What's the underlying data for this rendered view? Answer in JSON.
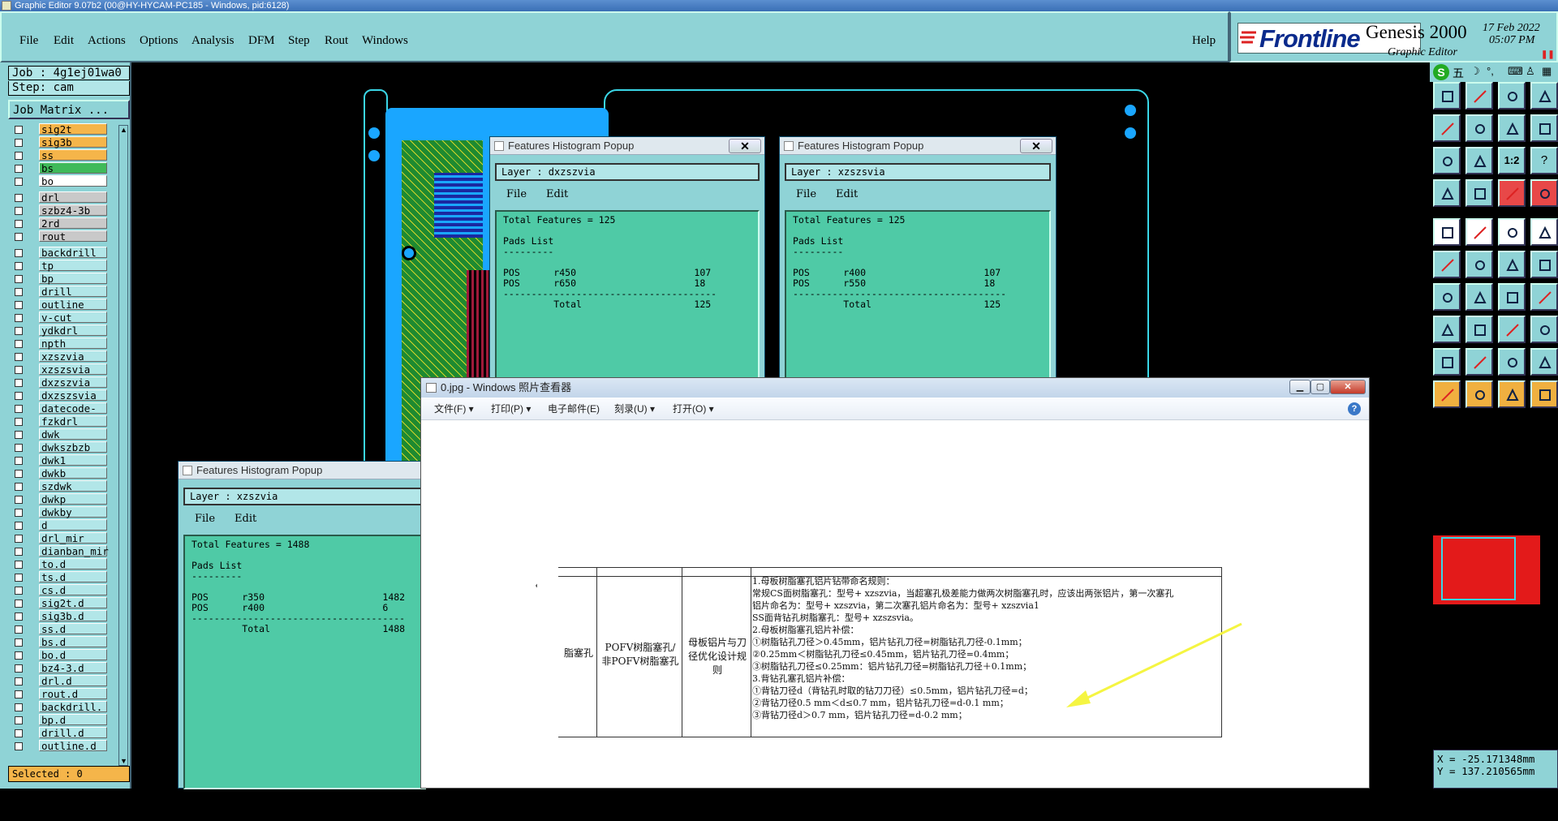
{
  "titlebar": {
    "title": "Graphic Editor 9.07b2 (00@HY-HYCAM-PC185 - Windows, pid:6128)"
  },
  "menubar": {
    "items": [
      "File",
      "Edit",
      "Actions",
      "Options",
      "Analysis",
      "DFM",
      "Step",
      "Rout",
      "Windows"
    ],
    "help": "Help"
  },
  "brand": {
    "logo": "Frontline",
    "product": "Genesis 2000",
    "subtitle": "Graphic Editor",
    "date": "17 Feb 2022",
    "time": "05:07 PM",
    "ime": "五"
  },
  "job": {
    "job": "Job : 4g1ej01wa0",
    "step": "Step: cam",
    "matrix": "Job Matrix ..."
  },
  "layers": [
    {
      "name": "sig2t",
      "color": "orange"
    },
    {
      "name": "sig3b",
      "color": "orange"
    },
    {
      "name": "ss",
      "color": "orange"
    },
    {
      "name": "bs",
      "color": "green"
    },
    {
      "name": "bo",
      "color": "white"
    },
    {
      "name": "drl",
      "color": "grey"
    },
    {
      "name": "szbz4-3b",
      "color": "grey"
    },
    {
      "name": "2rd",
      "color": "grey"
    },
    {
      "name": "rout",
      "color": "grey"
    },
    {
      "name": "backdrill",
      "color": "cyan"
    },
    {
      "name": "tp",
      "color": "cyan"
    },
    {
      "name": "bp",
      "color": "cyan"
    },
    {
      "name": "drill",
      "color": "cyan"
    },
    {
      "name": "outline",
      "color": "cyan"
    },
    {
      "name": "v-cut",
      "color": "cyan"
    },
    {
      "name": "ydkdrl",
      "color": "cyan"
    },
    {
      "name": "npth",
      "color": "cyan"
    },
    {
      "name": "xzszvia",
      "color": "cyan"
    },
    {
      "name": "xzszsvia",
      "color": "cyan"
    },
    {
      "name": "dxzszvia",
      "color": "cyan"
    },
    {
      "name": "dxzszsvia",
      "color": "cyan"
    },
    {
      "name": "datecode-to",
      "color": "cyan"
    },
    {
      "name": "fzkdrl",
      "color": "cyan"
    },
    {
      "name": "dwk",
      "color": "cyan"
    },
    {
      "name": "dwkszbzb",
      "color": "cyan"
    },
    {
      "name": "dwk1",
      "color": "cyan"
    },
    {
      "name": "dwkb",
      "color": "cyan"
    },
    {
      "name": "szdwk",
      "color": "cyan"
    },
    {
      "name": "dwkp",
      "color": "cyan"
    },
    {
      "name": "dwkby",
      "color": "cyan"
    },
    {
      "name": "d",
      "color": "cyan"
    },
    {
      "name": "drl_mir",
      "color": "cyan"
    },
    {
      "name": "dianban_mir",
      "color": "cyan"
    },
    {
      "name": "to.d",
      "color": "cyan"
    },
    {
      "name": "ts.d",
      "color": "cyan"
    },
    {
      "name": "cs.d",
      "color": "cyan"
    },
    {
      "name": "sig2t.d",
      "color": "cyan"
    },
    {
      "name": "sig3b.d",
      "color": "cyan"
    },
    {
      "name": "ss.d",
      "color": "cyan"
    },
    {
      "name": "bs.d",
      "color": "cyan"
    },
    {
      "name": "bo.d",
      "color": "cyan"
    },
    {
      "name": "bz4-3.d",
      "color": "cyan"
    },
    {
      "name": "drl.d",
      "color": "cyan"
    },
    {
      "name": "rout.d",
      "color": "cyan"
    },
    {
      "name": "backdrill.",
      "color": "cyan"
    },
    {
      "name": "bp.d",
      "color": "cyan"
    },
    {
      "name": "drill.d",
      "color": "cyan"
    },
    {
      "name": "outline.d",
      "color": "cyan"
    }
  ],
  "selected": "Selected : 0",
  "popups": [
    {
      "title": "Features Histogram Popup",
      "layer": "Layer :  dxzszvia",
      "menu": [
        "File",
        "Edit"
      ],
      "body": "Total Features = 125\n\nPads List\n---------\n\nPOS      r450                     107\nPOS      r650                     18\n--------------------------------------\n         Total                    125"
    },
    {
      "title": "Features Histogram Popup",
      "layer": "Layer :  xzszsvia",
      "menu": [
        "File",
        "Edit"
      ],
      "body": "Total Features = 125\n\nPads List\n---------\n\nPOS      r400                     107\nPOS      r550                     18\n--------------------------------------\n         Total                    125"
    },
    {
      "title": "Features Histogram Popup",
      "layer": "Layer :  xzszvia",
      "menu": [
        "File",
        "Edit"
      ],
      "body": "Total Features = 1488\n\nPads List\n---------\n\nPOS      r350                     1482\nPOS      r400                     6\n--------------------------------------\n         Total                    1488"
    }
  ],
  "viewer": {
    "title": "0.jpg - Windows 照片查看器",
    "menu": [
      "文件(F)",
      "打印(P)",
      "电子邮件(E)",
      "刻录(U)",
      "打开(O)"
    ],
    "doc": {
      "col1": "脂塞孔",
      "col2": "POFV树脂塞孔/非POFV树脂塞孔",
      "col3": "母板铝片与刀径优化设计规则",
      "rules": [
        "1.母板树脂塞孔铝片钻带命名规则：",
        "常规CS面树脂塞孔：型号+ xzszvia，当超塞孔极差能力做两次树脂塞孔时，应该出两张铝片，第一次塞孔",
        "铝片命名为：型号+ xzszvia，第二次塞孔铝片命名为：型号+ xzszvia1",
        "SS面背钻孔树脂塞孔：型号+ xzszsvia。",
        "2.母板树脂塞孔铝片补偿：",
        "①树脂钻孔刀径＞0.45mm，铝片钻孔刀径=树脂钻孔刀径-0.1mm；",
        "②0.25mm＜树脂钻孔刀径≤0.45mm，铝片钻孔刀径=0.4mm；",
        "③树脂钻孔刀径≤0.25mm：铝片钻孔刀径=树脂钻孔刀径＋0.1mm；",
        "3.背钻孔塞孔铝片补偿：",
        "①背钻刀径d（背钻孔时取的钻刀刀径）≤0.5mm，铝片钻孔刀径=d；",
        "②背钻刀径0.5 mm＜d≤0.7 mm，铝片钻孔刀径=d-0.1 mm；",
        "③背钻刀径d＞0.7 mm，铝片钻孔刀径=d-0.2 mm；"
      ]
    }
  },
  "coords": {
    "x": "X = -25.171348mm",
    "y": "Y = 137.210565mm"
  },
  "toolbar_buttons": [
    "1:2",
    "?"
  ]
}
